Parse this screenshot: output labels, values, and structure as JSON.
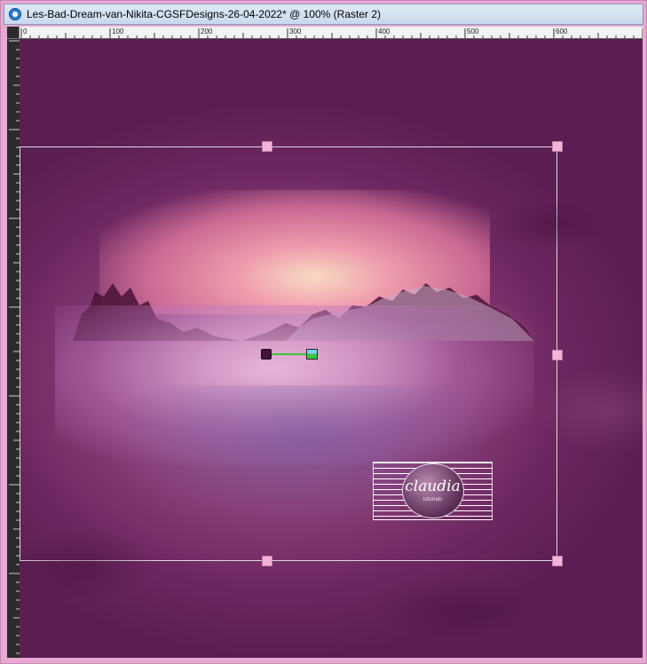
{
  "window": {
    "title": "Les-Bad-Dream-van-Nikita-CGSFDesigns-26-04-2022* @ 100% (Raster 2)",
    "app_icon": "paint-shop-pro-icon"
  },
  "ruler": {
    "labels": [
      "0",
      "100",
      "200",
      "300",
      "400",
      "500",
      "600"
    ]
  },
  "canvas": {
    "layer": "Raster 2",
    "zoom": "100%"
  },
  "watermark": {
    "name": "claudia",
    "subtitle": "tutorials"
  },
  "colors": {
    "selection_handle": "#f4b3d9",
    "background_main": "#8a3f78",
    "window_frame": "#e9a7d3"
  }
}
